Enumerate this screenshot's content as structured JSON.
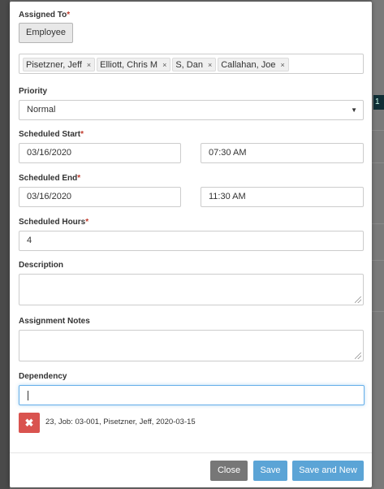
{
  "background": {
    "tab_badge": "1"
  },
  "assigned_to": {
    "label": "Assigned To",
    "required_mark": "*",
    "mode_button": "Employee",
    "tags": [
      {
        "name": "Pisetzner, Jeff",
        "remove": "×"
      },
      {
        "name": "Elliott, Chris M",
        "remove": "×"
      },
      {
        "name": "S, Dan",
        "remove": "×"
      },
      {
        "name": "Callahan, Joe",
        "remove": "×"
      }
    ]
  },
  "priority": {
    "label": "Priority",
    "value": "Normal",
    "caret": "▼"
  },
  "scheduled_start": {
    "label": "Scheduled Start",
    "required_mark": "*",
    "date": "03/16/2020",
    "time": "07:30 AM"
  },
  "scheduled_end": {
    "label": "Scheduled End",
    "required_mark": "*",
    "date": "03/16/2020",
    "time": "11:30 AM"
  },
  "scheduled_hours": {
    "label": "Scheduled Hours",
    "required_mark": "*",
    "value": "4"
  },
  "description": {
    "label": "Description",
    "value": ""
  },
  "assignment_notes": {
    "label": "Assignment Notes",
    "value": ""
  },
  "dependency": {
    "label": "Dependency",
    "value": "",
    "delete_glyph": "✖",
    "item_text": "23, Job: 03-001, Pisetzner, Jeff, 2020-03-15"
  },
  "footer": {
    "close_label": "Close",
    "save_label": "Save",
    "save_new_label": "Save and New"
  },
  "colors": {
    "primary_button": "#5ba4d6",
    "close_button": "#777777",
    "danger_button": "#d9534f",
    "required_mark": "#c0392b",
    "focus_border": "#66afe9"
  }
}
